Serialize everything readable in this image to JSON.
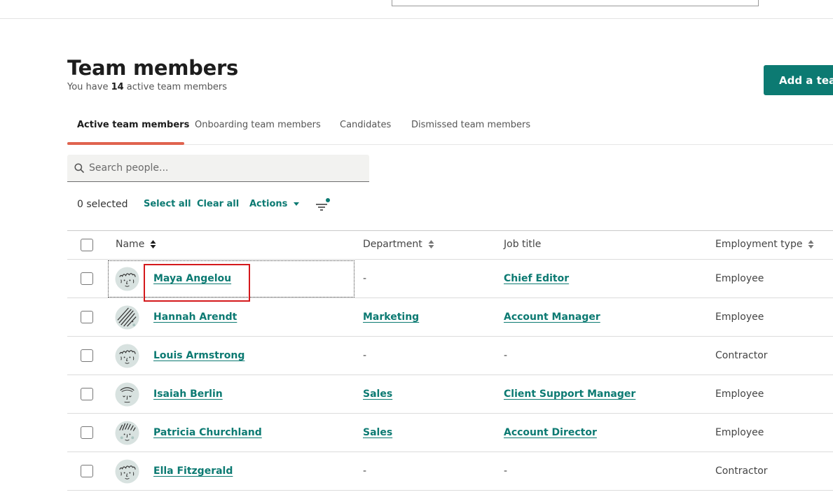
{
  "header": {
    "title": "Team members",
    "subtitle_prefix": "You have ",
    "active_count": "14",
    "subtitle_suffix": " active team members",
    "add_button": "Add a team member"
  },
  "tabs": [
    {
      "label": "Active team members",
      "active": true
    },
    {
      "label": "Onboarding team members",
      "active": false
    },
    {
      "label": "Candidates",
      "active": false
    },
    {
      "label": "Dismissed team members",
      "active": false
    }
  ],
  "search": {
    "placeholder": "Search people...",
    "value": ""
  },
  "selection": {
    "count_label": "0 selected",
    "select_all": "Select all",
    "clear_all": "Clear all",
    "actions": "Actions"
  },
  "table": {
    "columns": {
      "name": "Name",
      "department": "Department",
      "job_title": "Job title",
      "employment_type": "Employment type"
    },
    "rows": [
      {
        "name": "Maya Angelou",
        "department": "-",
        "job_title": "Chief Editor",
        "employment_type": "Employee",
        "avatar_icon": "curly-hair-avatar-icon"
      },
      {
        "name": "Hannah Arendt",
        "department": "Marketing",
        "job_title": "Account Manager",
        "employment_type": "Employee",
        "avatar_icon": "striped-hair-avatar-icon"
      },
      {
        "name": "Louis Armstrong",
        "department": "-",
        "job_title": "-",
        "employment_type": "Contractor",
        "avatar_icon": "curly-hair-avatar-icon"
      },
      {
        "name": "Isaiah Berlin",
        "department": "Sales",
        "job_title": "Client Support Manager",
        "employment_type": "Employee",
        "avatar_icon": "bald-avatar-icon"
      },
      {
        "name": "Patricia Churchland",
        "department": "Sales",
        "job_title": "Account Director",
        "employment_type": "Employee",
        "avatar_icon": "spiky-hair-avatar-icon"
      },
      {
        "name": "Ella Fitzgerald",
        "department": "-",
        "job_title": "-",
        "employment_type": "Contractor",
        "avatar_icon": "curly-hair-avatar-icon"
      }
    ]
  },
  "colors": {
    "accent": "#0c7a72",
    "tab_underline": "#e0634f",
    "highlight": "#d4191c",
    "avatar_bg": "#d8e2e0"
  }
}
